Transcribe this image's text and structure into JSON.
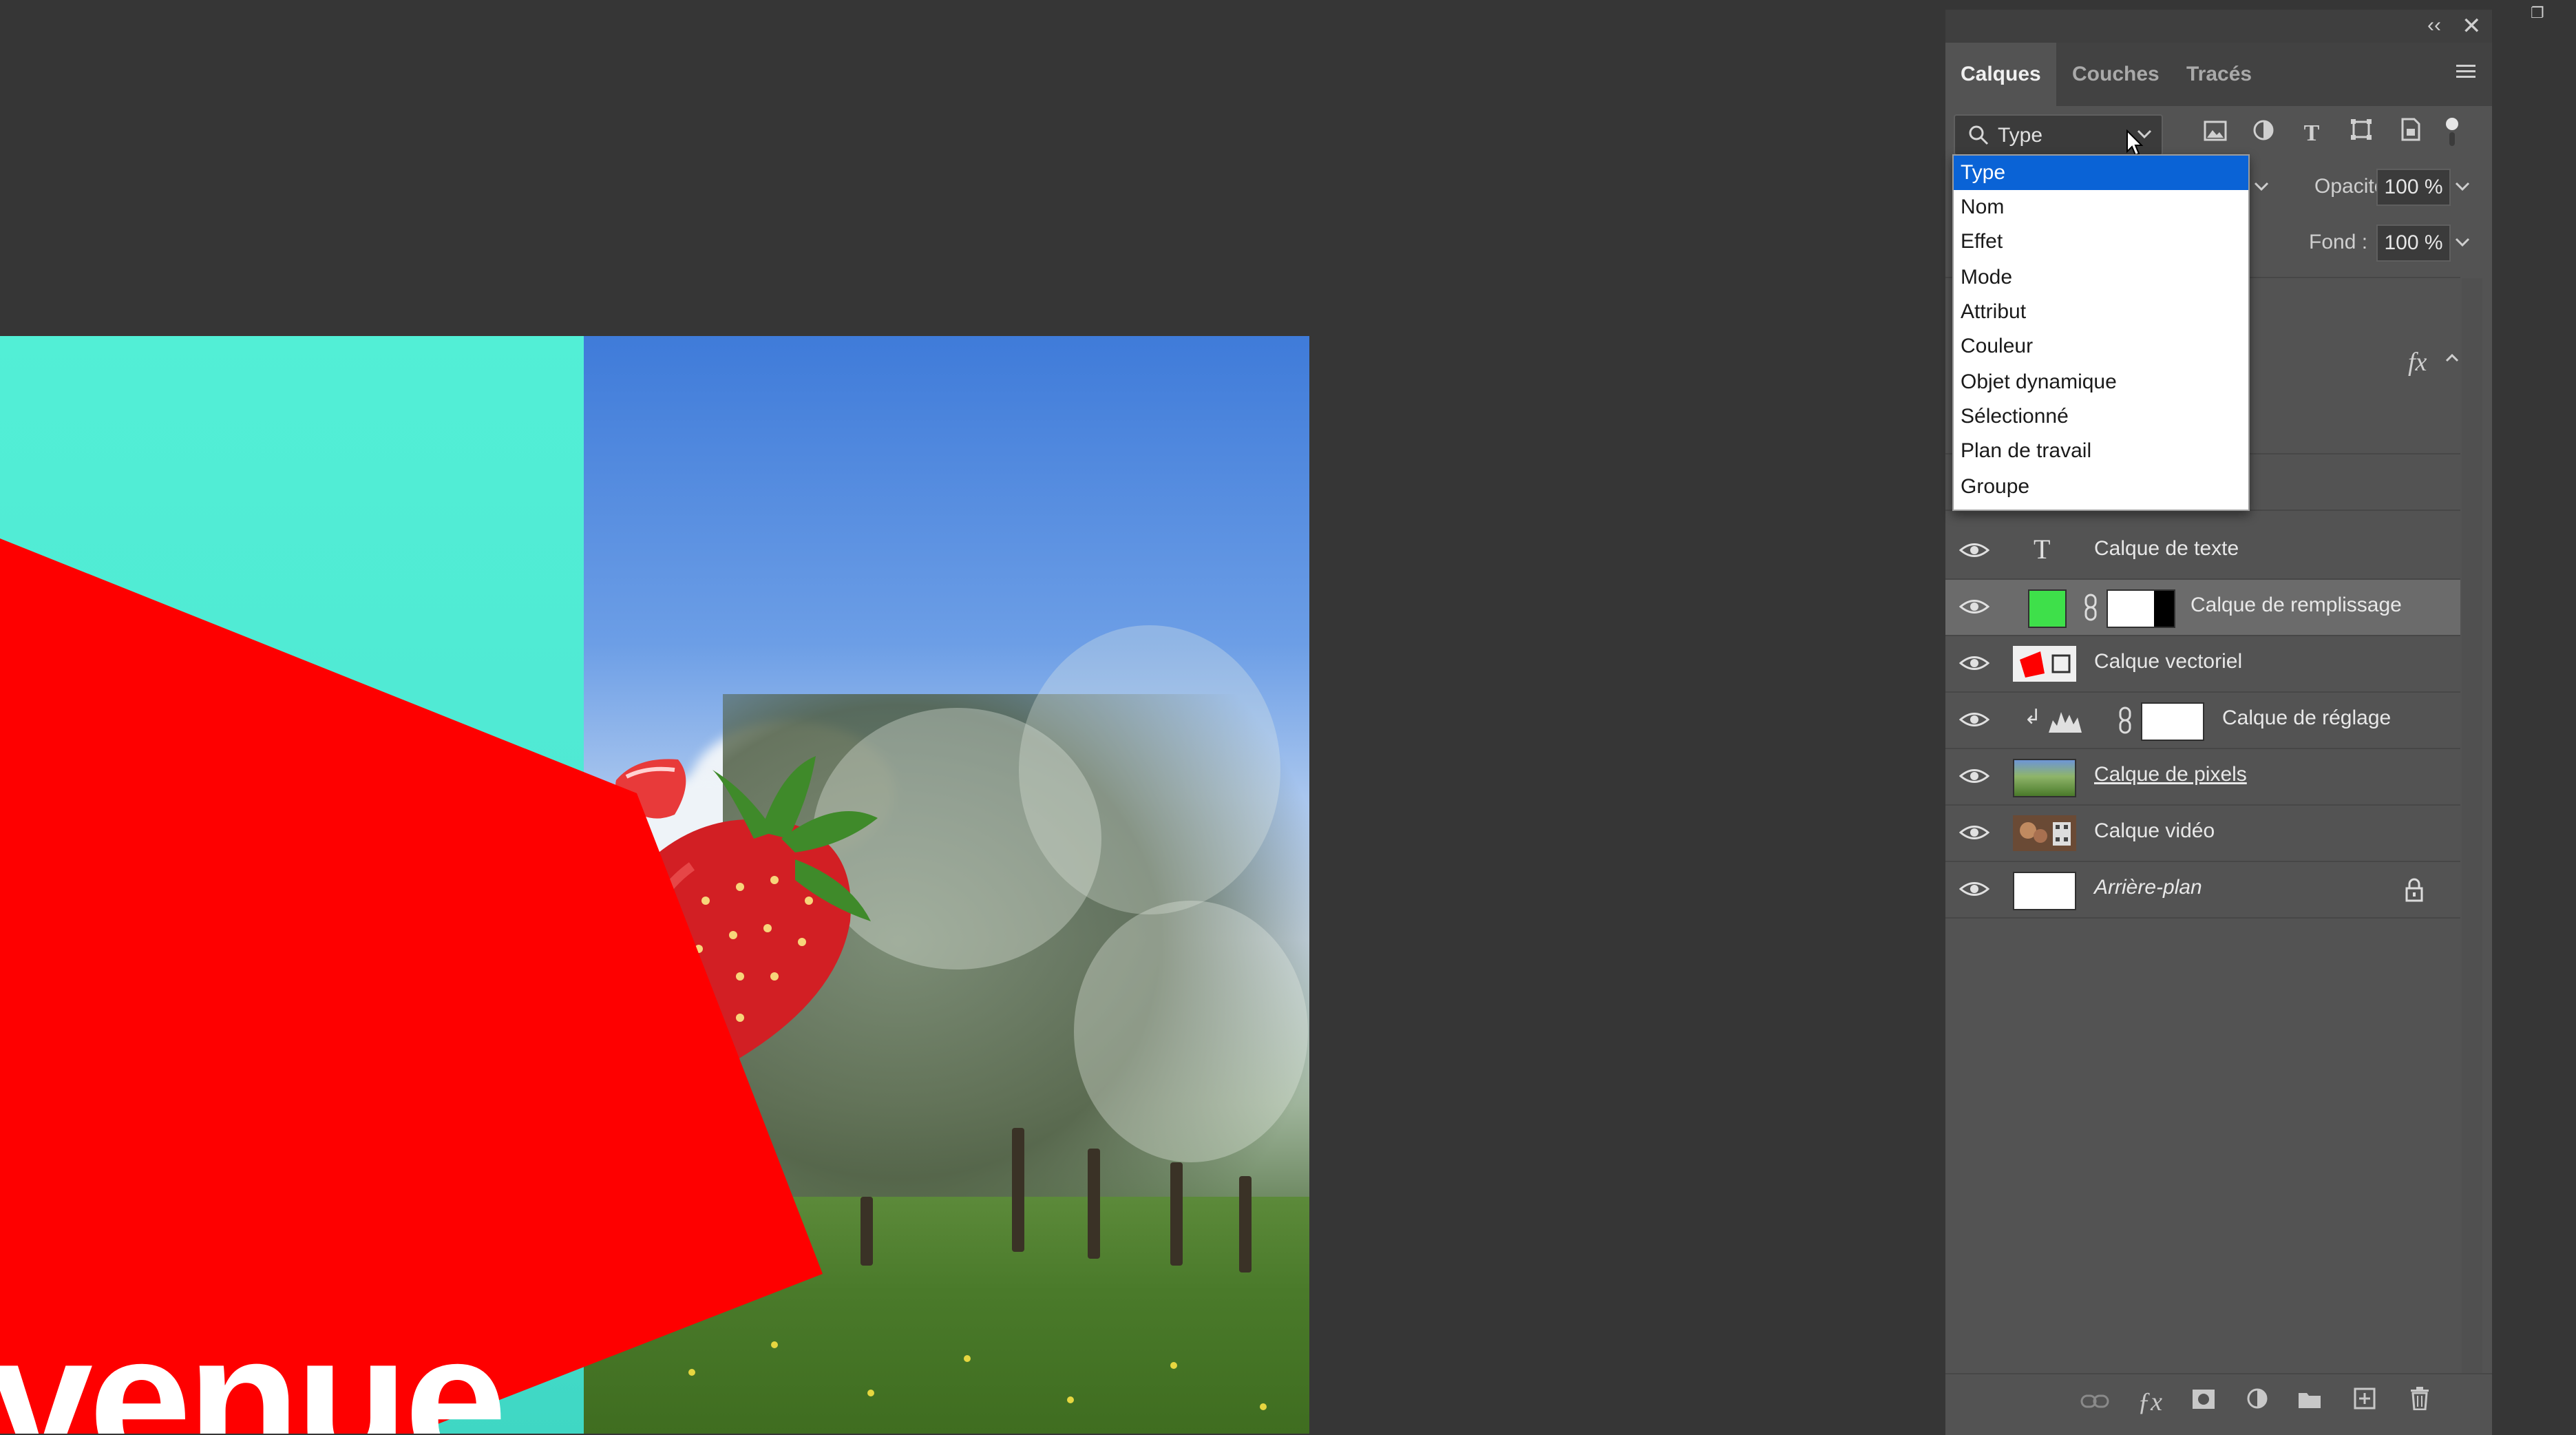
{
  "panel": {
    "tabs": [
      {
        "label": "Calques",
        "active": true
      },
      {
        "label": "Couches",
        "active": false
      },
      {
        "label": "Tracés",
        "active": false
      }
    ],
    "filter": {
      "selected": "Type",
      "options": [
        "Type",
        "Nom",
        "Effet",
        "Mode",
        "Attribut",
        "Couleur",
        "Objet dynamique",
        "Sélectionné",
        "Plan de travail",
        "Groupe"
      ],
      "highlighted_index": 0
    },
    "opacity": {
      "label": "Opacité :",
      "value": "100 %"
    },
    "fill": {
      "label": "Fond :",
      "value": "100 %"
    },
    "fx_label": "fx",
    "layers": [
      {
        "name": "Calque de texte",
        "kind": "text"
      },
      {
        "name": "Calque de remplissage",
        "kind": "fill",
        "selected": true
      },
      {
        "name": "Calque vectoriel",
        "kind": "vector"
      },
      {
        "name": "Calque de réglage",
        "kind": "adjustment"
      },
      {
        "name": "Calque de pixels",
        "kind": "pixel"
      },
      {
        "name": "Calque vidéo",
        "kind": "video"
      },
      {
        "name": "Arrière-plan",
        "kind": "background",
        "locked": true
      }
    ]
  },
  "canvas": {
    "text": "venue"
  },
  "colors": {
    "accent": "#0a63d6",
    "fill_green": "#3ee04a",
    "red_shape": "#fe0000",
    "cyan_panel": "#4fecd4"
  }
}
